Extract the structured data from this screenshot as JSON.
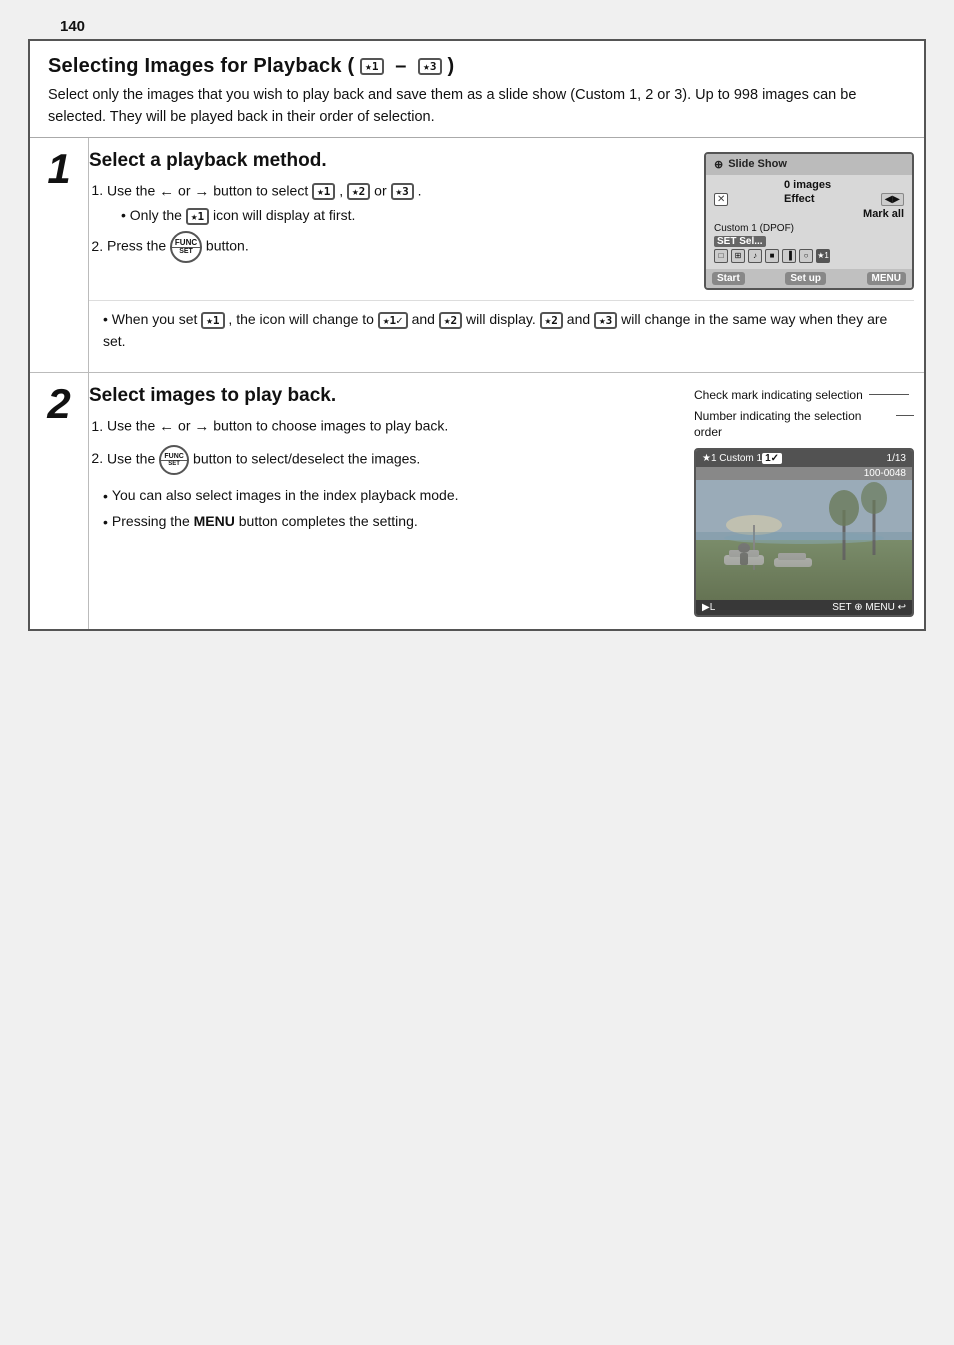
{
  "page": {
    "number": "140",
    "title": "Selecting Images for Playback (★1 – ★3)",
    "intro": "Select only the images that you wish to play back and save them as a slide show (Custom 1, 2 or 3). Up to 998 images can be selected. They will be played back in their order of selection.",
    "step1": {
      "number": "1",
      "title": "Select a playback method.",
      "items": [
        "Use the ← or → button to select ★1 , ★2 or ★3 .",
        "Only the ★1 icon will display at first.",
        "Press the FUNC button."
      ],
      "note": "When you set ★1 , the icon will change to ★1✓ and ★2 will display. ★2 and ★3 will change in the same way when they are set.",
      "screen": {
        "title": "Slide Show",
        "rows": [
          {
            "label": "",
            "value": "0 images"
          },
          {
            "label": "✕",
            "value": "Effect"
          },
          {
            "label": "",
            "value": "Mark all"
          }
        ],
        "custom_label": "Custom 1 (DPOF)",
        "set_label": "SET Sel...",
        "footer_left": "Start",
        "footer_mid": "Set up",
        "footer_right": "MENU"
      }
    },
    "step2": {
      "number": "2",
      "title": "Select images to play back.",
      "items": [
        "Use the ← or → button to choose images to play back.",
        "Use the FUNC button to select/deselect the images."
      ],
      "bullets": [
        "You can also select images in the index playback mode.",
        "Pressing the MENU button completes the setting."
      ],
      "callouts": [
        "Check mark indicating selection",
        "Number indicating the selection order"
      ],
      "screen": {
        "topbar_left": "★1  Custom 1",
        "topbar_mid": "1✓",
        "topbar_right": "1/13",
        "file_label": "100-0048",
        "footer_left": "▶L",
        "footer_right": "SET  ⊕ MENU ↩"
      }
    }
  }
}
